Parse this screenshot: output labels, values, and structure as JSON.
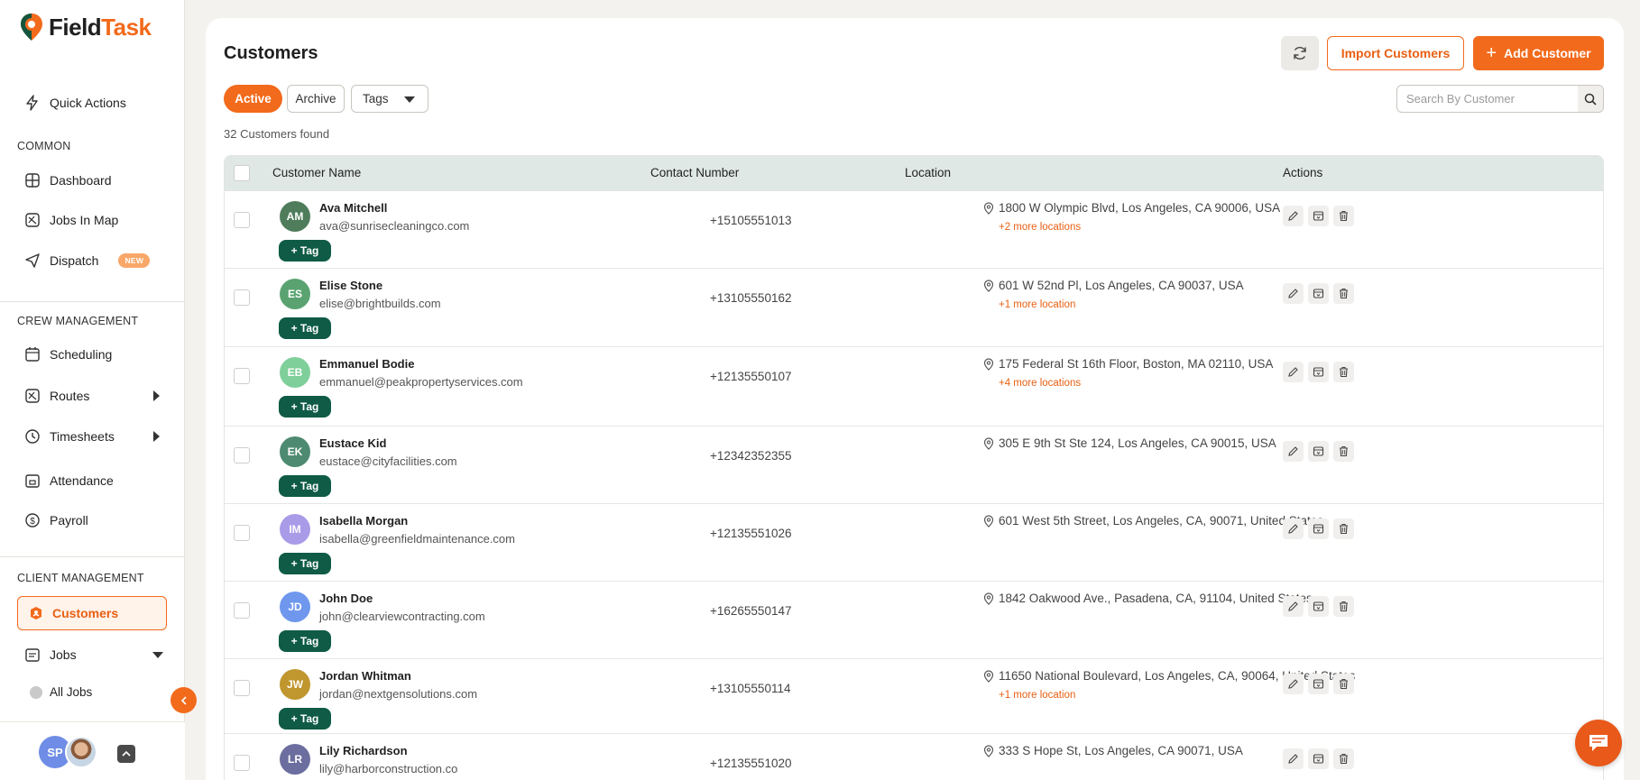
{
  "brand": {
    "name_part1": "Field",
    "name_part2": "Task",
    "accent": "#f26a1b"
  },
  "sidebar": {
    "quick_actions": "Quick Actions",
    "sections": {
      "common": "COMMON",
      "crew": "CREW MANAGEMENT",
      "client": "CLIENT MANAGEMENT"
    },
    "items": {
      "dashboard": "Dashboard",
      "jobs_in_map": "Jobs In Map",
      "dispatch": "Dispatch",
      "dispatch_badge": "NEW",
      "scheduling": "Scheduling",
      "routes": "Routes",
      "timesheets": "Timesheets",
      "attendance": "Attendance",
      "payroll": "Payroll",
      "customers": "Customers",
      "jobs": "Jobs",
      "all_jobs": "All Jobs"
    },
    "footer": {
      "user_initials": "SP"
    }
  },
  "header": {
    "title": "Customers",
    "import_label": "Import Customers",
    "add_label": "Add Customer"
  },
  "filters": {
    "active": "Active",
    "archive": "Archive",
    "tags": "Tags"
  },
  "search": {
    "placeholder": "Search By Customer"
  },
  "count_text": "32 Customers found",
  "table": {
    "columns": {
      "name": "Customer Name",
      "contact": "Contact Number",
      "location": "Location",
      "actions": "Actions"
    },
    "tag_label": "+ Tag",
    "rows": [
      {
        "initials": "AM",
        "avatar_color": "#4f7d5b",
        "name": "Ava Mitchell",
        "email": "ava@sunrisecleaningco.com",
        "phone": "+15105551013",
        "location": "1800 W Olympic Blvd, Los Angeles, CA 90006, USA",
        "more": "+2 more locations"
      },
      {
        "initials": "ES",
        "avatar_color": "#5aa371",
        "name": "Elise Stone",
        "email": "elise@brightbuilds.com",
        "phone": "+13105550162",
        "location": "601 W 52nd Pl, Los Angeles, CA 90037, USA",
        "more": "+1 more location"
      },
      {
        "initials": "EB",
        "avatar_color": "#7fcf9a",
        "name": "Emmanuel Bodie",
        "email": "emmanuel@peakpropertyservices.com",
        "phone": "+12135550107",
        "location": "175 Federal St 16th Floor, Boston, MA 02110, USA",
        "more": "+4 more locations"
      },
      {
        "initials": "EK",
        "avatar_color": "#4e8a72",
        "name": "Eustace Kid",
        "email": "eustace@cityfacilities.com",
        "phone": "+12342352355",
        "location": "305 E 9th St Ste 124, Los Angeles, CA 90015, USA",
        "more": ""
      },
      {
        "initials": "IM",
        "avatar_color": "#a99be8",
        "name": "Isabella Morgan",
        "email": "isabella@greenfieldmaintenance.com",
        "phone": "+12135551026",
        "location": "601 West 5th Street, Los Angeles, CA, 90071, United States",
        "more": ""
      },
      {
        "initials": "JD",
        "avatar_color": "#6f97ee",
        "name": "John Doe",
        "email": "john@clearviewcontracting.com",
        "phone": "+16265550147",
        "location": "1842 Oakwood Ave., Pasadena, CA, 91104, United States",
        "more": ""
      },
      {
        "initials": "JW",
        "avatar_color": "#c0962e",
        "name": "Jordan Whitman",
        "email": "jordan@nextgensolutions.com",
        "phone": "+13105550114",
        "location": "11650 National Boulevard, Los Angeles, CA, 90064, United States",
        "more": "+1 more location"
      },
      {
        "initials": "LR",
        "avatar_color": "#6b6e9e",
        "name": "Lily Richardson",
        "email": "lily@harborconstruction.co",
        "phone": "+12135551020",
        "location": "333 S Hope St, Los Angeles, CA 90071, USA",
        "more": ""
      }
    ]
  }
}
